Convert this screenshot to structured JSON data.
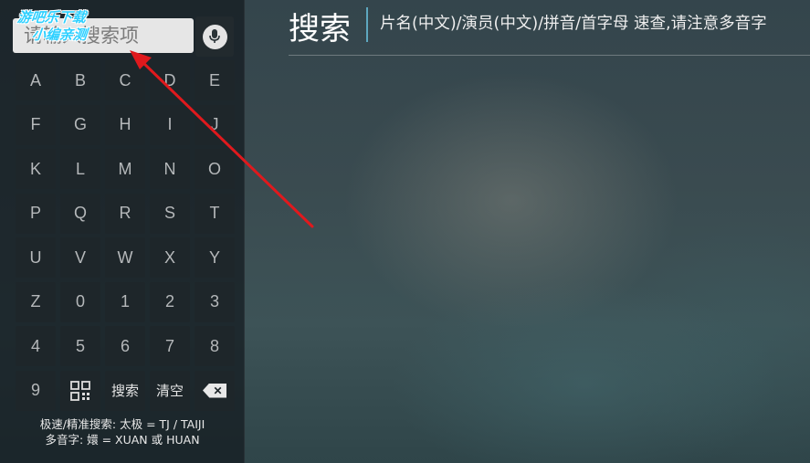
{
  "watermark": {
    "line1": "游吧乐下载",
    "line2": "小编亲测"
  },
  "search": {
    "placeholder": "请输入搜索项",
    "value": ""
  },
  "voice": {
    "icon": "microphone-icon"
  },
  "keyboard": {
    "keys": [
      "A",
      "B",
      "C",
      "D",
      "E",
      "F",
      "G",
      "H",
      "I",
      "J",
      "K",
      "L",
      "M",
      "N",
      "O",
      "P",
      "Q",
      "R",
      "S",
      "T",
      "U",
      "V",
      "W",
      "X",
      "Y",
      "Z",
      "0",
      "1",
      "2",
      "3",
      "4",
      "5",
      "6",
      "7",
      "8",
      "9"
    ],
    "qr_icon": "qr-code-icon",
    "search_label": "搜索",
    "clear_label": "清空",
    "backspace_icon": "backspace-icon"
  },
  "hints": {
    "line1": "极速/精准搜索: 太极 = TJ / TAIJI",
    "line2": "多音字: 嬛 = XUAN 或 HUAN"
  },
  "header": {
    "title": "搜索",
    "hint": "片名(中文)/演员(中文)/拼音/首字母 速查,请注意多音字"
  },
  "colors": {
    "accent_divider": "#5ea7bf",
    "annotation_arrow": "#e0191d",
    "watermark": "#2ed0ff"
  }
}
